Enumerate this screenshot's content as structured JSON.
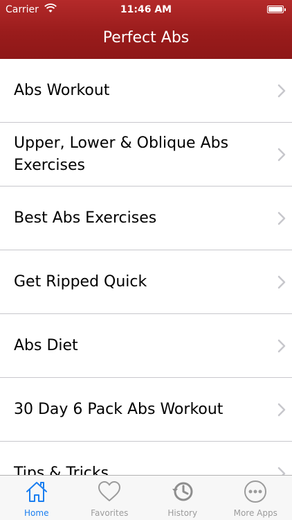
{
  "status_bar": {
    "carrier": "Carrier",
    "time": "11:46 AM"
  },
  "header": {
    "title": "Perfect Abs",
    "background_color": "#9e1d1d"
  },
  "list": {
    "items": [
      {
        "label": "Abs Workout"
      },
      {
        "label": "Upper, Lower & Oblique Abs Exercises"
      },
      {
        "label": "Best Abs Exercises"
      },
      {
        "label": "Get Ripped Quick"
      },
      {
        "label": "Abs Diet"
      },
      {
        "label": "30 Day 6 Pack Abs Workout"
      },
      {
        "label": "Tips & Tricks"
      }
    ],
    "chevron_icon": "chevron-right-icon"
  },
  "tabbar": {
    "active_color": "#1a7ef0",
    "inactive_color": "#9b9b9b",
    "tabs": [
      {
        "label": "Home",
        "icon": "home-icon",
        "active": true
      },
      {
        "label": "Favorites",
        "icon": "heart-icon",
        "active": false
      },
      {
        "label": "History",
        "icon": "history-clock-icon",
        "active": false
      },
      {
        "label": "More Apps",
        "icon": "more-dots-icon",
        "active": false
      }
    ]
  }
}
